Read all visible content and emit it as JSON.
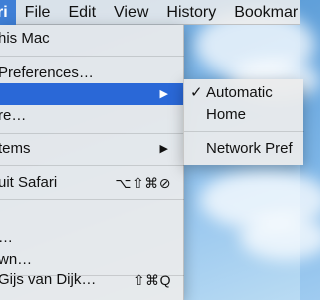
{
  "menubar": {
    "items": [
      "ri",
      "File",
      "Edit",
      "View",
      "History",
      "Bookmar"
    ]
  },
  "main_menu": {
    "items": [
      {
        "label": "his Mac",
        "shortcut": "",
        "arrow": false
      },
      {
        "label": " Preferences…",
        "shortcut": "",
        "arrow": false
      },
      {
        "label": "",
        "shortcut": "",
        "arrow": true
      },
      {
        "label": "re…",
        "shortcut": "",
        "arrow": false
      },
      {
        "label": "tems",
        "shortcut": "",
        "arrow": true
      },
      {
        "label": "uit Safari",
        "shortcut": "⌥⇧⌘⊘",
        "arrow": false
      },
      {
        "label": "",
        "shortcut": "",
        "arrow": false
      },
      {
        "label": "…",
        "shortcut": "",
        "arrow": false
      },
      {
        "label": "wn…",
        "shortcut": "",
        "arrow": false
      },
      {
        "label": " Gijs van Dijk…",
        "shortcut": "⇧⌘Q",
        "arrow": false
      }
    ],
    "arrow_glyph": "▶"
  },
  "submenu": {
    "items": [
      {
        "label": "Automatic",
        "checked": true
      },
      {
        "label": "Home",
        "checked": false
      },
      {
        "label": "Network Pref",
        "checked": false
      }
    ],
    "check_glyph": "✓"
  },
  "colors": {
    "highlight": "#2a68d7",
    "menu_bg": "#ececec"
  }
}
